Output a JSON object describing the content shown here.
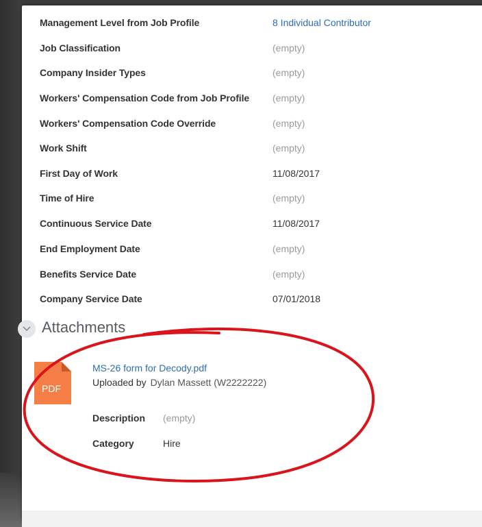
{
  "fields": [
    {
      "label": "Management Level from Job Profile",
      "value": "8 Individual Contributor",
      "style": "link"
    },
    {
      "label": "Job Classification",
      "value": "(empty)",
      "style": "empty"
    },
    {
      "label": "Company Insider Types",
      "value": "(empty)",
      "style": "empty"
    },
    {
      "label": "Workers' Compensation Code from Job Profile",
      "value": "(empty)",
      "style": "empty"
    },
    {
      "label": "Workers' Compensation Code Override",
      "value": "(empty)",
      "style": "empty"
    },
    {
      "label": "Work Shift",
      "value": "(empty)",
      "style": "empty"
    },
    {
      "label": "First Day of Work",
      "value": "11/08/2017",
      "style": "normal"
    },
    {
      "label": "Time of Hire",
      "value": "(empty)",
      "style": "empty"
    },
    {
      "label": "Continuous Service Date",
      "value": "11/08/2017",
      "style": "normal"
    },
    {
      "label": "End Employment Date",
      "value": "(empty)",
      "style": "empty"
    },
    {
      "label": "Benefits Service Date",
      "value": "(empty)",
      "style": "empty"
    },
    {
      "label": "Company Service Date",
      "value": "07/01/2018",
      "style": "normal"
    }
  ],
  "attachments": {
    "title": "Attachments",
    "file": {
      "icon_label": "PDF",
      "name": "MS-26 form for Decody.pdf",
      "uploaded_by_label": "Uploaded by",
      "uploaded_by_name": "Dylan Massett (W2222222)",
      "description_label": "Description",
      "description_value": "(empty)",
      "category_label": "Category",
      "category_value": "Hire"
    }
  },
  "colors": {
    "link": "#2b6eb4",
    "empty": "#9a9a9a",
    "pdf_icon": "#f47e45",
    "annotation": "#d9141b"
  },
  "icons": {
    "collapse": "chevron-down-icon",
    "file": "pdf-file-icon"
  }
}
